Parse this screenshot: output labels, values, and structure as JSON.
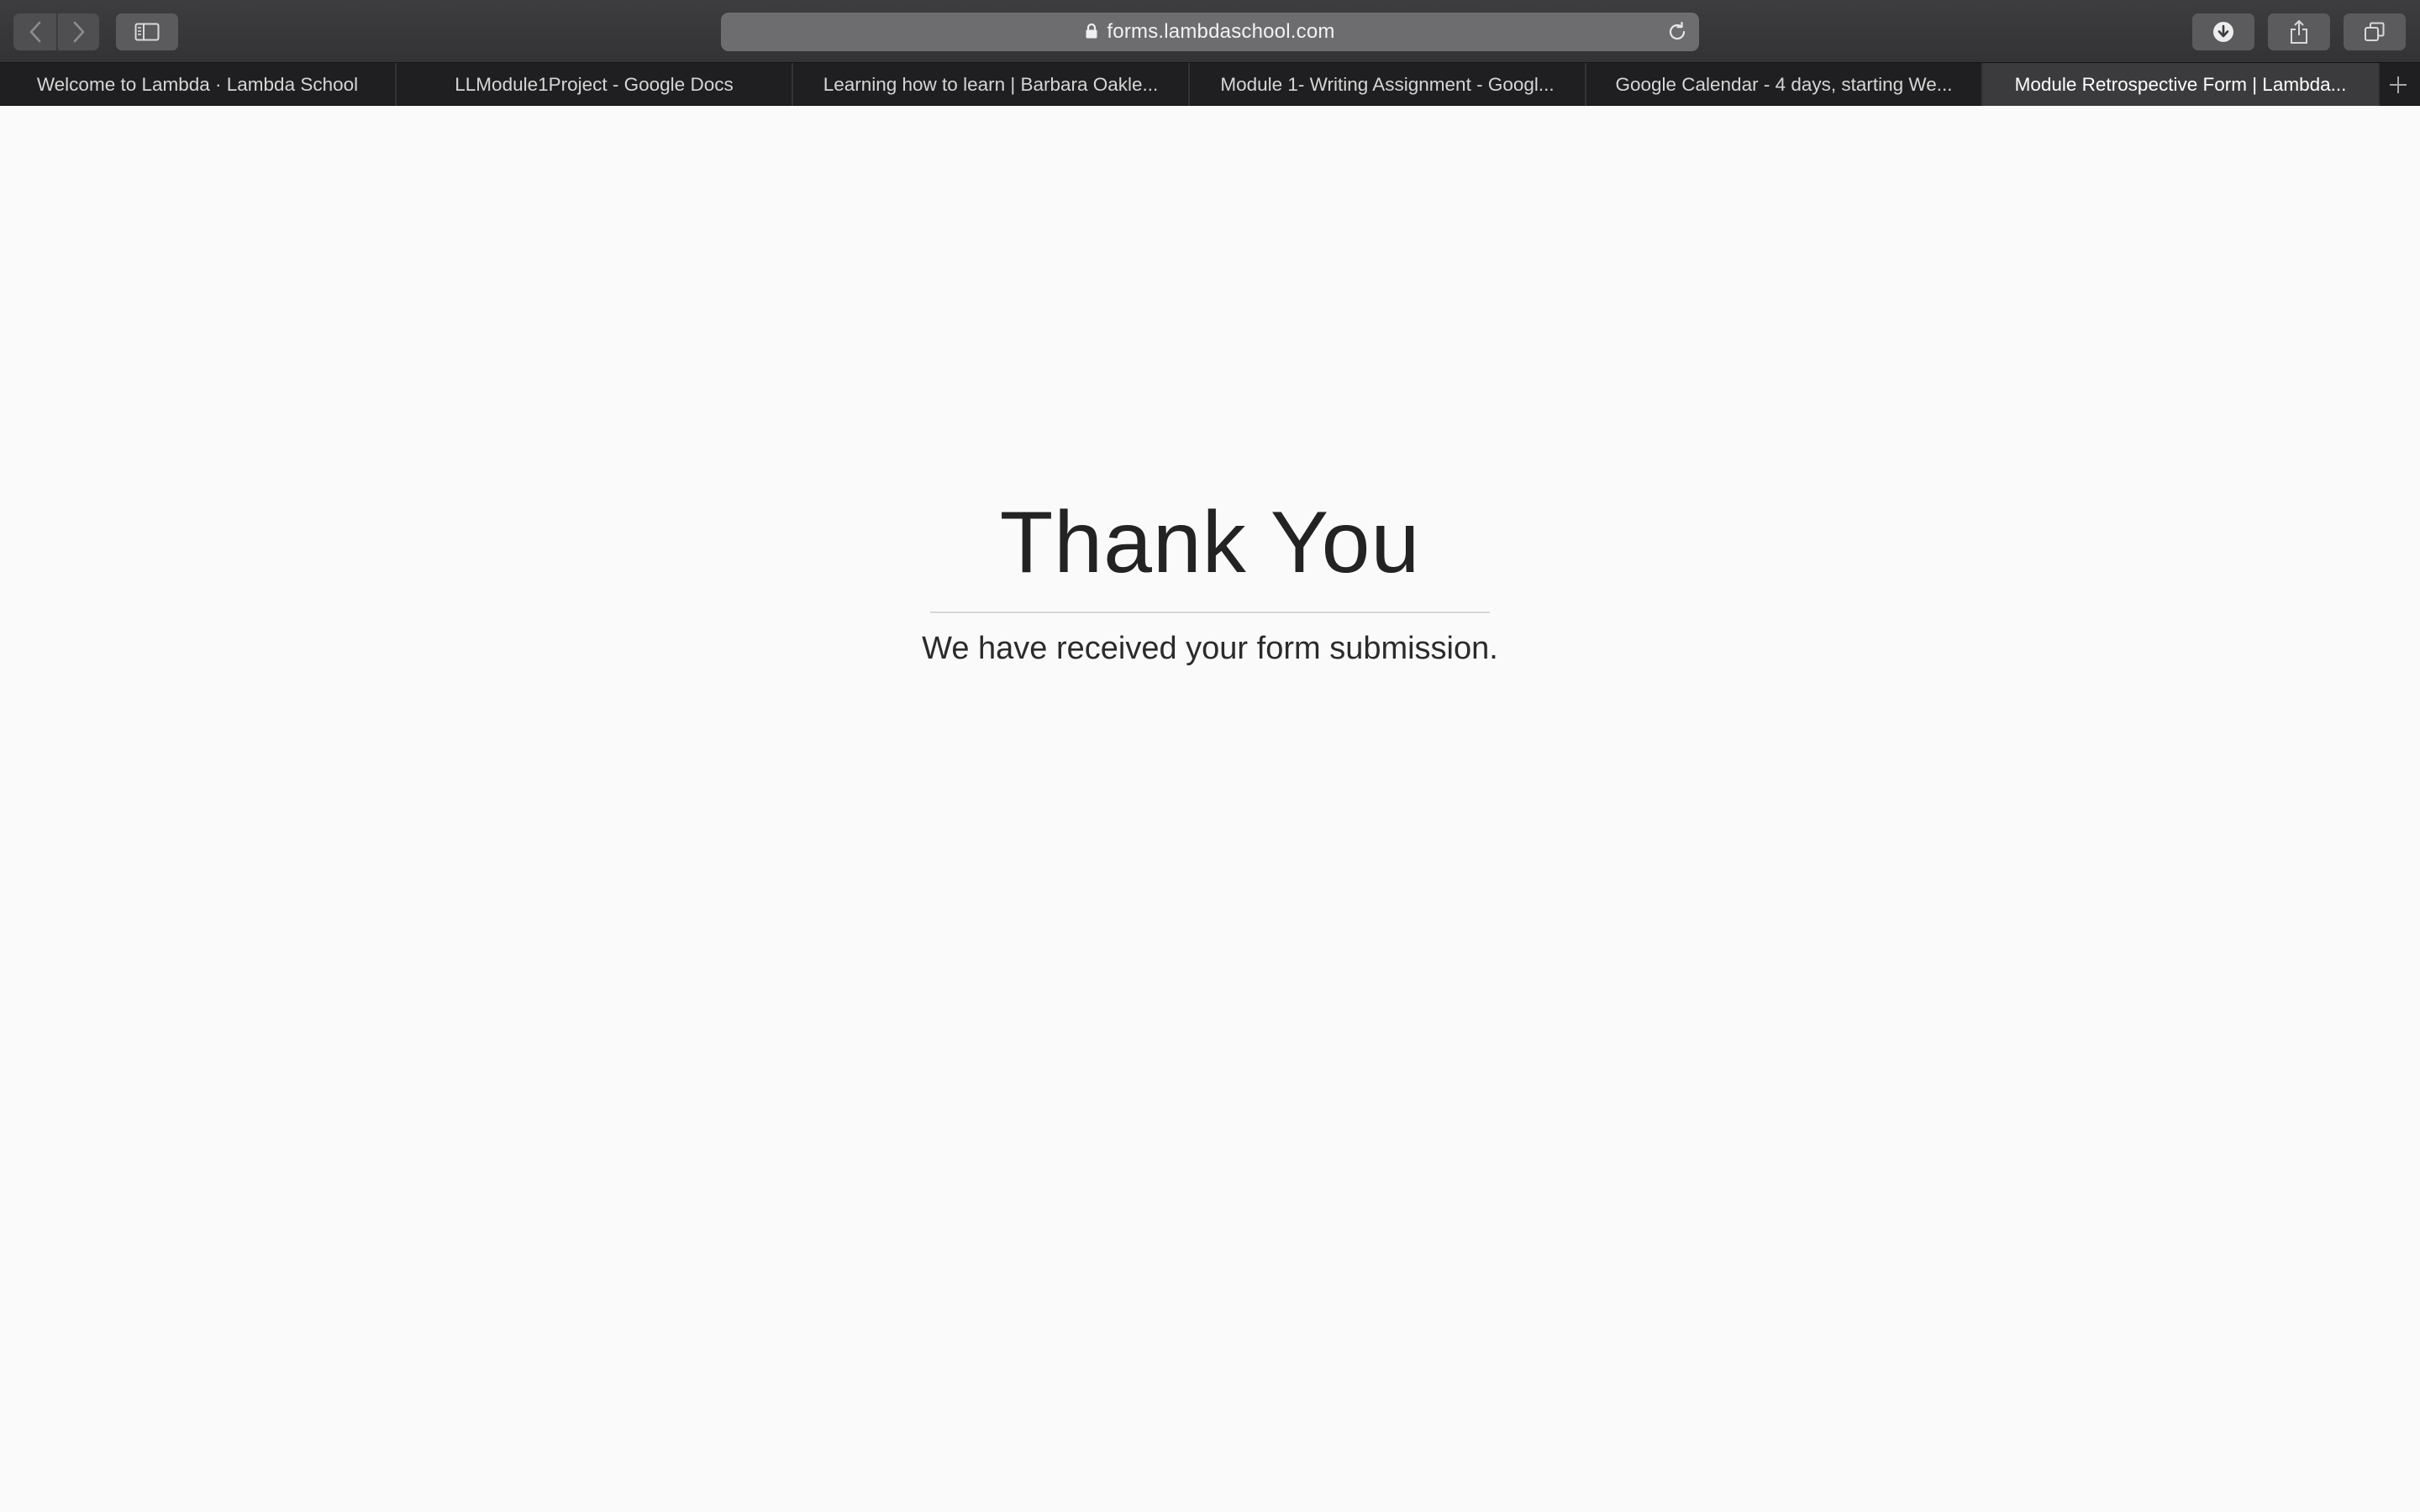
{
  "browser": {
    "url": "forms.lambdaschool.com",
    "icons": {
      "back": "chevron-left-icon",
      "forward": "chevron-right-icon",
      "sidebar": "sidebar-icon",
      "lock": "lock-icon",
      "reload": "reload-icon",
      "downloads": "download-icon",
      "share": "share-icon",
      "tabs_overview": "tabs-overview-icon",
      "new_tab": "plus-icon"
    },
    "tabs": [
      {
        "title": "Welcome to Lambda · Lambda School",
        "active": false
      },
      {
        "title": "LLModule1Project - Google Docs",
        "active": false
      },
      {
        "title": "Learning how to learn | Barbara Oakle...",
        "active": false
      },
      {
        "title": "Module 1- Writing Assignment - Googl...",
        "active": false
      },
      {
        "title": "Google Calendar - 4 days, starting We...",
        "active": false
      },
      {
        "title": "Module Retrospective Form | Lambda...",
        "active": true
      }
    ]
  },
  "page": {
    "heading": "Thank You",
    "message": "We have received your form submission."
  }
}
